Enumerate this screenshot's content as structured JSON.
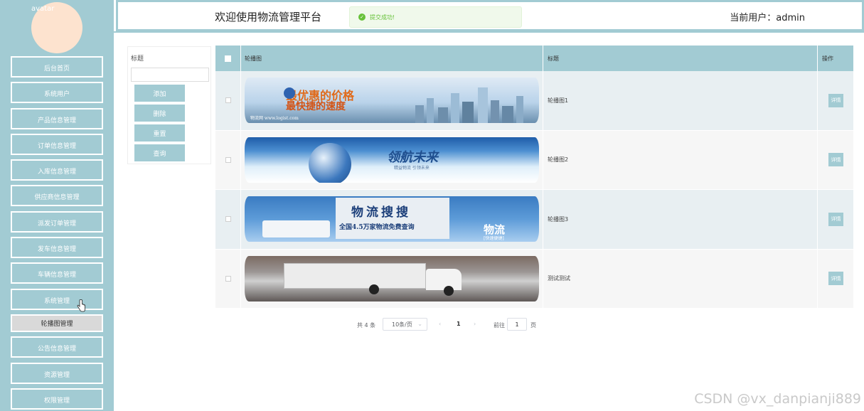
{
  "sidebar": {
    "avatar_alt": "avatar",
    "items": [
      {
        "label": "后台首页"
      },
      {
        "label": "系统用户"
      },
      {
        "label": "产品信息管理"
      },
      {
        "label": "订单信息管理"
      },
      {
        "label": "入库信息管理"
      },
      {
        "label": "供应商信息管理"
      },
      {
        "label": "派发订单管理"
      },
      {
        "label": "发车信息管理"
      },
      {
        "label": "车辆信息管理"
      },
      {
        "label": "系统管理"
      },
      {
        "label": "轮播图管理"
      },
      {
        "label": "公告信息管理"
      },
      {
        "label": "资源管理"
      },
      {
        "label": "权限管理"
      }
    ],
    "active_index": 10
  },
  "header": {
    "title": "欢迎使用物流管理平台",
    "current_user": "当前用户：admin"
  },
  "toast": {
    "message": "提交成功!",
    "icon": "check-circle-icon",
    "color": "#67c23a"
  },
  "search": {
    "label": "标题",
    "value": "",
    "buttons": {
      "add": "添加",
      "delete": "删除",
      "reset": "重置",
      "query": "查询"
    }
  },
  "table": {
    "columns": [
      "轮播图",
      "标题",
      "操作"
    ],
    "rows": [
      {
        "title": "轮播图1",
        "action": "详情",
        "banner_text": [
          "最优惠的价格",
          "最快捷的速度"
        ],
        "banner_small": "物流网 www.logist.com"
      },
      {
        "title": "轮播图2",
        "action": "详情",
        "banner_text": [
          "领航未来"
        ],
        "banner_small": "精益物流 引领未来"
      },
      {
        "title": "轮播图3",
        "action": "详情",
        "banner_text": [
          "物流搜搜",
          "全国4.5万家物流免费查询",
          "物流"
        ],
        "banner_small": "[快速便捷]"
      },
      {
        "title": "测试测试",
        "action": "详情",
        "banner_text": [],
        "banner_small": ""
      }
    ]
  },
  "pagination": {
    "total": "共 4 条",
    "page_size": "10条/页",
    "prev": "‹",
    "current": "1",
    "next": "›",
    "goto_label": "前往",
    "goto_value": "1",
    "page_suffix": "页"
  },
  "watermark": "CSDN @vx_danpianji889",
  "colors": {
    "accent": "#a2cbd3",
    "avatar_bg": "#fde3cf",
    "success": "#67c23a"
  }
}
